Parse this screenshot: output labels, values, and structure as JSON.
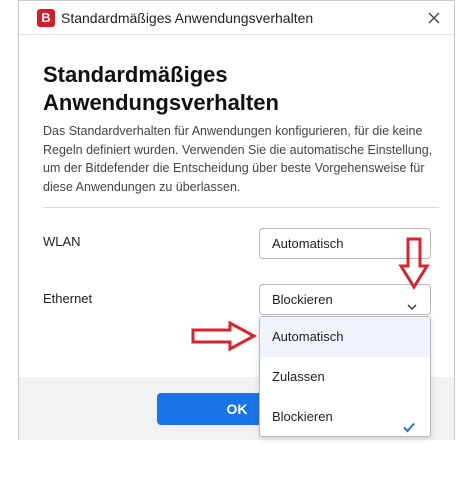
{
  "window": {
    "title": "Standardmäßiges Anwendungsverhalten",
    "logo_letter": "B"
  },
  "dialog": {
    "heading": "Standardmäßiges Anwendungsverhalten",
    "description": "Das Standardverhalten für Anwendungen konfigurieren, für die keine Regeln definiert wurden. Verwenden Sie die automatische Einstellung, um der Bitdefender die Entscheidung über beste Vorgehensweise für diese Anwendungen zu überlassen."
  },
  "settings": [
    {
      "label": "WLAN",
      "value": "Automatisch"
    },
    {
      "label": "Ethernet",
      "value": "Blockieren"
    }
  ],
  "dropdown": {
    "options": [
      "Automatisch",
      "Zulassen",
      "Blockieren"
    ],
    "selected": "Blockieren",
    "hovered": "Automatisch"
  },
  "footer": {
    "ok_label": "OK"
  },
  "colors": {
    "accent": "#1a73e8",
    "brand": "#d21f27",
    "annotation_arrow": "#d9232d"
  },
  "icons": [
    "bitdefender-logo-icon",
    "close-icon",
    "chevron-down-icon",
    "checkmark-icon",
    "red-arrow-right-icon",
    "red-arrow-down-icon"
  ]
}
